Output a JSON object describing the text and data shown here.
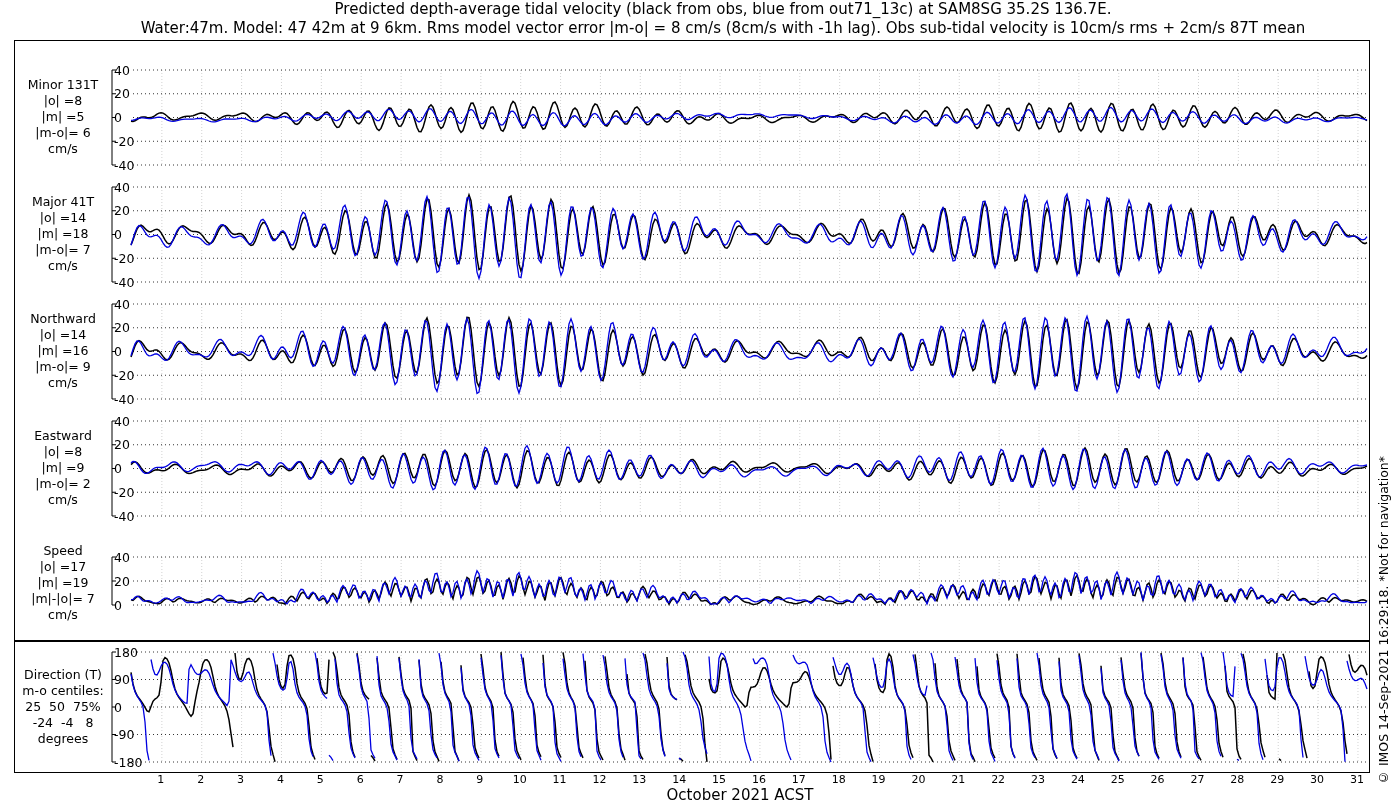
{
  "title": [
    "Predicted depth-average tidal velocity (black from obs, blue from out71_13c) at SAM8SG 35.2S 136.7E.",
    "Water:47m. Model: 47 42m at 9 6km. Rms model vector error |m-o| = 8 cm/s (8cm/s with -1h lag). Obs sub-tidal velocity is 10cm/s rms + 2cm/s 87T mean"
  ],
  "panels": [
    {
      "kind": "velocity",
      "label_lines": [
        "Minor 131T",
        "|o| =8",
        "|m| =5",
        "|m-o|= 6",
        "cm/s"
      ],
      "yticks": [
        "40",
        "20",
        "0",
        "-20",
        "-40"
      ]
    },
    {
      "kind": "velocity",
      "label_lines": [
        "Major 41T",
        "|o| =14",
        "|m| =18",
        "|m-o|= 7",
        "cm/s"
      ],
      "yticks": [
        "40",
        "20",
        "0",
        "-20",
        "-40"
      ]
    },
    {
      "kind": "velocity",
      "label_lines": [
        "Northward",
        "|o| =14",
        "|m| =16",
        "|m-o|= 9",
        "cm/s"
      ],
      "yticks": [
        "40",
        "20",
        "0",
        "-20",
        "-40"
      ]
    },
    {
      "kind": "velocity",
      "label_lines": [
        "Eastward",
        "|o| =8",
        "|m| =9",
        "|m-o|= 2",
        "cm/s"
      ],
      "yticks": [
        "40",
        "20",
        "0",
        "-20",
        "-40"
      ]
    },
    {
      "kind": "speed",
      "label_lines": [
        "Speed",
        "|o| =17",
        "|m| =19",
        "|m|-|o|= 7",
        "cm/s"
      ],
      "yticks": [
        "40",
        "20",
        "0"
      ]
    },
    {
      "kind": "direction",
      "label_lines": [
        "Direction (T)",
        "m-o centiles:",
        "25  50  75%",
        "-24  -4   8",
        "degrees"
      ],
      "yticks": [
        "180",
        "90",
        "0",
        "-90",
        "-180"
      ]
    }
  ],
  "x_axis": {
    "ticks": [
      "1",
      "2",
      "3",
      "4",
      "5",
      "6",
      "7",
      "8",
      "9",
      "10",
      "11",
      "12",
      "13",
      "14",
      "15",
      "16",
      "17",
      "18",
      "19",
      "20",
      "21",
      "22",
      "23",
      "24",
      "25",
      "26",
      "27",
      "28",
      "29",
      "30",
      "31"
    ],
    "label": "October 2021 ACST"
  },
  "credit": "© IMOS 14-Sep-2021 16:29:18. *Not for navigation*"
}
